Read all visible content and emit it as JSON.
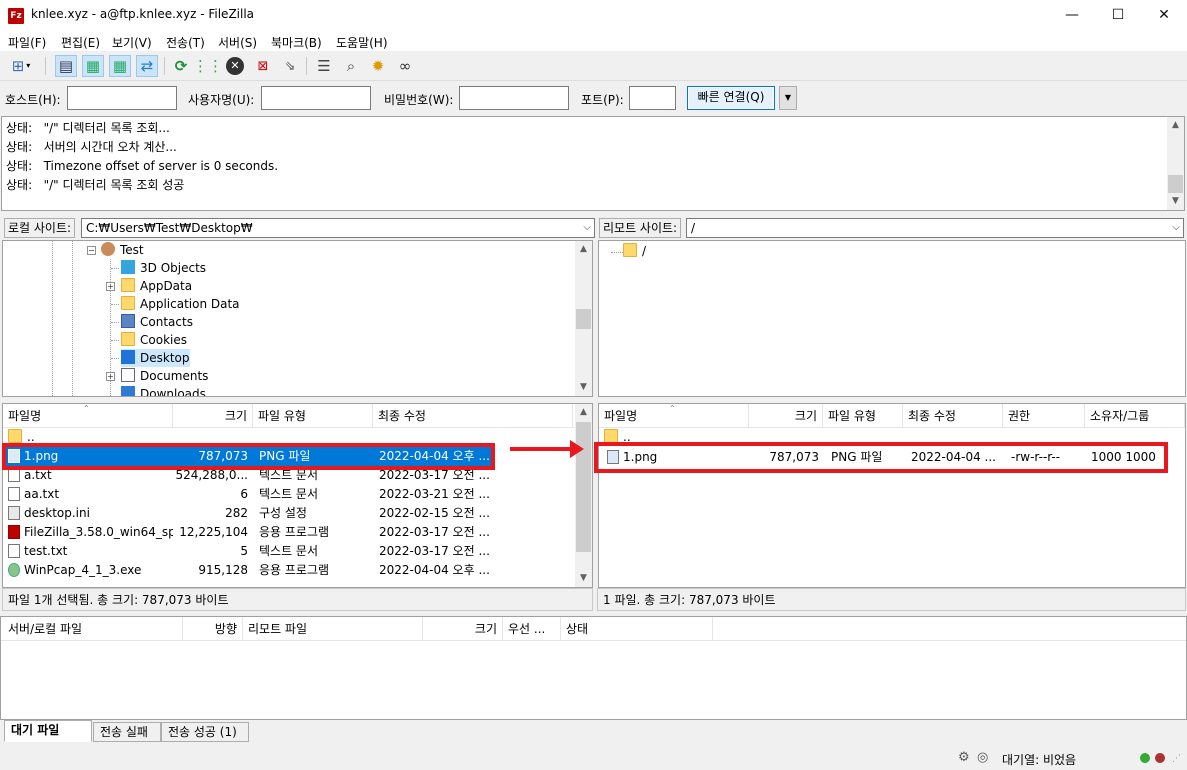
{
  "window": {
    "title": "knlee.xyz - a@ftp.knlee.xyz - FileZilla",
    "app_icon": "Fz",
    "controls": {
      "minimize": "—",
      "maximize": "☐",
      "close": "✕"
    }
  },
  "menu": [
    "파일(F)",
    "편집(E)",
    "보기(V)",
    "전송(T)",
    "서버(S)",
    "북마크(B)",
    "도움말(H)"
  ],
  "quickconnect": {
    "host_label": "호스트(H):",
    "user_label": "사용자명(U):",
    "pass_label": "비밀번호(W):",
    "port_label": "포트(P):",
    "connect_label": "빠른 연결(Q)",
    "host_value": "",
    "user_value": "",
    "pass_value": "",
    "port_value": ""
  },
  "log": [
    {
      "prefix": "상태:",
      "text": "\"/\" 디렉터리 목록 조회..."
    },
    {
      "prefix": "상태:",
      "text": "서버의 시간대 오차 계산..."
    },
    {
      "prefix": "상태:",
      "text": "Timezone offset of server is 0 seconds."
    },
    {
      "prefix": "상태:",
      "text": "\"/\" 디렉터리 목록 조회 성공"
    }
  ],
  "local": {
    "site_label": "로컬 사이트:",
    "path": "C:₩Users₩Test₩Desktop₩",
    "tree": [
      {
        "label": "Test",
        "icon": "user-folder-icon"
      },
      {
        "label": "3D Objects",
        "icon": "3d-objects-icon"
      },
      {
        "label": "AppData",
        "icon": "folder-icon"
      },
      {
        "label": "Application Data",
        "icon": "folder-icon"
      },
      {
        "label": "Contacts",
        "icon": "contacts-icon"
      },
      {
        "label": "Cookies",
        "icon": "folder-icon"
      },
      {
        "label": "Desktop",
        "icon": "desktop-icon"
      },
      {
        "label": "Documents",
        "icon": "documents-icon"
      },
      {
        "label": "Downloads",
        "icon": "downloads-icon"
      }
    ],
    "columns": [
      "파일명",
      "크기",
      "파일 유형",
      "최종 수정"
    ],
    "files": [
      {
        "name": "..",
        "size": "",
        "type": "",
        "modified": ""
      },
      {
        "name": "1.png",
        "size": "787,073",
        "type": "PNG 파일",
        "modified": "2022-04-04 오후 ..."
      },
      {
        "name": "a.txt",
        "size": "524,288,0...",
        "type": "텍스트 문서",
        "modified": "2022-03-17 오전 ..."
      },
      {
        "name": "aa.txt",
        "size": "6",
        "type": "텍스트 문서",
        "modified": "2022-03-21 오전 ..."
      },
      {
        "name": "desktop.ini",
        "size": "282",
        "type": "구성 설정",
        "modified": "2022-02-15 오전 ..."
      },
      {
        "name": "FileZilla_3.58.0_win64_sp...",
        "size": "12,225,104",
        "type": "응용 프로그램",
        "modified": "2022-03-17 오전 ..."
      },
      {
        "name": "test.txt",
        "size": "5",
        "type": "텍스트 문서",
        "modified": "2022-03-17 오전 ..."
      },
      {
        "name": "WinPcap_4_1_3.exe",
        "size": "915,128",
        "type": "응용 프로그램",
        "modified": "2022-04-04 오후 ..."
      }
    ],
    "status": "파일 1개 선택됨. 총 크기: 787,073 바이트"
  },
  "remote": {
    "site_label": "리모트 사이트:",
    "path": "/",
    "tree": [
      {
        "label": "/",
        "icon": "folder-icon"
      }
    ],
    "columns": [
      "파일명",
      "크기",
      "파일 유형",
      "최종 수정",
      "권한",
      "소유자/그룹"
    ],
    "files": [
      {
        "name": "..",
        "size": "",
        "type": "",
        "modified": "",
        "perm": "",
        "owner": ""
      },
      {
        "name": "1.png",
        "size": "787,073",
        "type": "PNG 파일",
        "modified": "2022-04-04 ...",
        "perm": "-rw-r--r--",
        "owner": "1000 1000"
      }
    ],
    "status": "1 파일. 총 크기: 787,073 바이트"
  },
  "queue": {
    "columns": [
      "서버/로컬 파일",
      "방향",
      "리모트 파일",
      "크기",
      "우선 ...",
      "상태"
    ],
    "tabs": [
      "대기 파일",
      "전송 실패",
      "전송 성공 (1)"
    ]
  },
  "statusbar": {
    "queue_text": "대기열: 비었음"
  },
  "colors": {
    "highlight": "#e8181e",
    "selection": "#0078d7"
  }
}
